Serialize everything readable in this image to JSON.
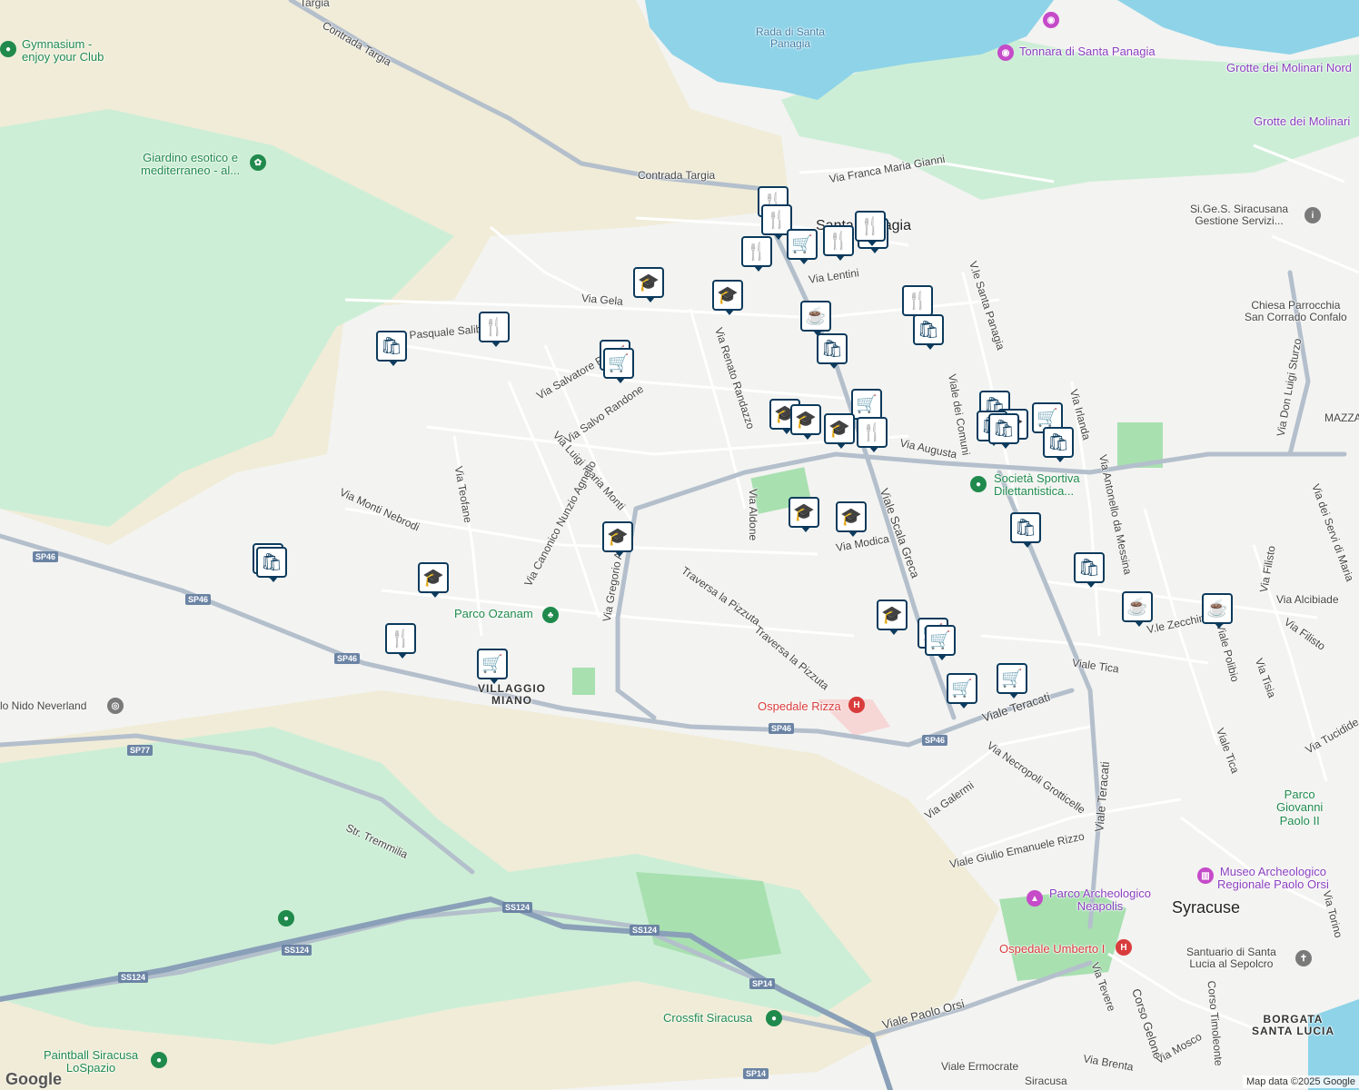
{
  "colors": {
    "water": "#8ed3e8",
    "green": "#cdeed6",
    "park": "#a8e0b0",
    "sand": "#f0ecd8",
    "road": "#ffffff",
    "major_road": "#b4bfcc",
    "marker_border": "#0b3a5c"
  },
  "attribution": {
    "logo": "Google",
    "map_data": "Map data ©2025 Google"
  },
  "labels": {
    "targia_top": "Targia",
    "gymnasium": "Gymnasium -\nenjoy your Club",
    "contrada_targia_1": "Contrada Targia",
    "contrada_targia_2": "Contrada Targia",
    "rada": "Rada di Santa\nPanagia",
    "tonnara": "Tonnara di Santa Panagia",
    "grotte_nord": "Grotte dei Molinari Nord",
    "grotte": "Grotte dei Molinari",
    "giardino": "Giardino esotico e\nmediterraneo - al...",
    "franca_maria": "Via Franca Maria Gianni",
    "santa_panagia": "Santa Panagia",
    "sigess": "Si.Ge.S. Siracusana\nGestione Servizi...",
    "chiesa": "Chiesa Parrocchia\nSan Corrado Confalo",
    "via_lentini": "Via Lentini",
    "via_gela": "Via Gela",
    "pasquale_salibra": "Via Pasquale Salibra",
    "salvatore_ra": "Via Salvatore Ra",
    "salvo_randone": "Via Salvo Randone",
    "renato_randazzo": "Via Renato Randazzo",
    "viale_santa_panagia": "V.le Santa Panagia",
    "viale_dei_comuni": "Viale dei Comuni",
    "via_irlanda": "Via Irlanda",
    "don_luigi": "Via Don Luigi Sturzo",
    "mazza": "MAZZA",
    "via_augusta": "Via Augusta",
    "societa": "Società Sportiva\nDilettantistica...",
    "luigi_maria_monti": "Via Luigi Maria Monti",
    "canonico": "Via Canonico Nunzio Agnello",
    "monti_nebrodi": "Via Monti Nebrodi",
    "teofane": "Via Teofane",
    "via_aldone": "Via Aldone",
    "viale_scala_greca": "Viale Scala Greca",
    "via_modica": "Via Modica",
    "antonello": "Via Antonello da Messina",
    "servi_maria": "Via dei Servi di Maria",
    "via_filisto_1": "Via Filisto",
    "via_filisto_2": "Via Filisto",
    "via_alcibiade": "Via Alcibiade",
    "gregorio": "Via Gregorio Asba",
    "parco_ozanam": "Parco Ozanam",
    "traversa_1": "Traversa la Pizzuta",
    "traversa_2": "Traversa la Pizzuta",
    "zecchino": "V.le Zecchino",
    "viale_polibio": "Viale Polibio",
    "via_tisia": "Via Tisia",
    "viale_tica_1": "Viale Tica",
    "viale_tica_2": "Viale Tica",
    "via_tucidide": "Via Tucidide",
    "villaggio_miano": "VILLAGGIO\nMIANO",
    "neverland": "lo Nido Neverland",
    "ospedale_rizza": "Ospedale Rizza",
    "viale_teracati_1": "Viale Teracati",
    "viale_teracati_2": "Viale Teracati",
    "necropoli": "Via Necropoli Grotticelle",
    "via_galermi": "Via Galermi",
    "emanuele_rizzo": "Viale Giulio Emanuele Rizzo",
    "parco_giovanni": "Parco\nGiovanni\nPaolo II",
    "str_tremmilia": "Str. Tremmilia",
    "museo": "Museo Archeologico\nRegionale Paolo Orsi",
    "parco_neapolis": "Parco Archeologico\nNeapolis",
    "syracuse": "Syracuse",
    "via_torino": "Via Torino",
    "ospedale_umberto": "Ospedale Umberto I",
    "santuario": "Santuario di Santa\nLucia al Sepolcro",
    "via_tevere": "Via Tevere",
    "corso_gelone": "Corso Gelone",
    "corso_timoleonte": "Corso Timoleonte",
    "via_mosco": "Via Mosco",
    "borgata": "BORGATA\nSANTA LUCIA",
    "viale_paolo_orsi": "Viale Paolo Orsi",
    "crossfit": "Crossfit Siracusa",
    "via_brenta": "Via Brenta",
    "viale_ermocrate": "Viale Ermocrate",
    "siracusa_station": "Siracusa",
    "paintball": "Paintball Siracusa\nLoSpazio"
  },
  "road_shields": [
    "SP46",
    "SP46",
    "SP46",
    "SP46",
    "SP46",
    "SP77",
    "SS124",
    "SS124",
    "SS124",
    "SS124",
    "SP14"
  ],
  "marker_icons": {
    "restaurant": "🍴",
    "grocery": "🛒",
    "shop": "🛍",
    "school": "🎓",
    "cafe": "☕"
  },
  "markers": [
    {
      "type": "restaurant"
    },
    {
      "type": "restaurant"
    },
    {
      "type": "grocery"
    },
    {
      "type": "restaurant"
    },
    {
      "type": "restaurant"
    },
    {
      "type": "restaurant"
    },
    {
      "type": "restaurant"
    },
    {
      "type": "school"
    },
    {
      "type": "school"
    },
    {
      "type": "cafe"
    },
    {
      "type": "restaurant"
    },
    {
      "type": "shop"
    },
    {
      "type": "restaurant"
    },
    {
      "type": "shop"
    },
    {
      "type": "shop"
    },
    {
      "type": "grocery"
    },
    {
      "type": "grocery"
    },
    {
      "type": "shop"
    },
    {
      "type": "school"
    },
    {
      "type": "school"
    },
    {
      "type": "grocery"
    },
    {
      "type": "school"
    },
    {
      "type": "school"
    },
    {
      "type": "restaurant"
    },
    {
      "type": "shop"
    },
    {
      "type": "shop"
    },
    {
      "type": "grocery"
    },
    {
      "type": "shop"
    },
    {
      "type": "shop"
    },
    {
      "type": "shop"
    },
    {
      "type": "school"
    },
    {
      "type": "school"
    },
    {
      "type": "school"
    },
    {
      "type": "shop"
    },
    {
      "type": "shop"
    },
    {
      "type": "cafe"
    },
    {
      "type": "cafe"
    },
    {
      "type": "school"
    },
    {
      "type": "restaurant"
    },
    {
      "type": "grocery"
    },
    {
      "type": "school"
    },
    {
      "type": "grocery"
    },
    {
      "type": "grocery"
    },
    {
      "type": "grocery"
    },
    {
      "type": "grocery"
    }
  ]
}
